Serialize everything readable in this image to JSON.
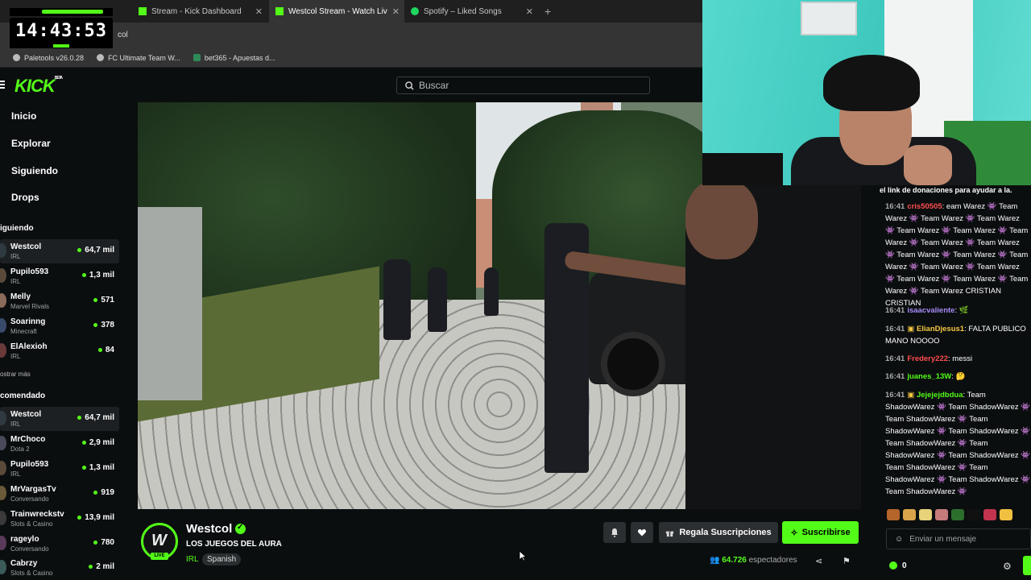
{
  "overlay": {
    "clock": "14:43:53"
  },
  "browser": {
    "tabs": [
      {
        "label": "Stream - Kick Dashboard",
        "active": false
      },
      {
        "label": "Westcol Stream - Watch Liv",
        "active": true
      },
      {
        "label": "Spotify – Liked Songs",
        "active": false
      }
    ],
    "address_fragment": "col",
    "bookmarks": [
      "Paletools v26.0.28",
      "FC Ultimate Team W...",
      "bet365 - Apuestas d..."
    ]
  },
  "header": {
    "logo": "KICK",
    "logo_badge": "BETA",
    "search_placeholder": "Buscar"
  },
  "sidebar": {
    "nav": [
      "Inicio",
      "Explorar",
      "Siguiendo",
      "Drops"
    ],
    "following_title": "iguiendo",
    "following": [
      {
        "name": "Westcol",
        "category": "IRL",
        "viewers": "64,7 mil"
      },
      {
        "name": "Pupilo593",
        "category": "IRL",
        "viewers": "1,3 mil"
      },
      {
        "name": "Melly",
        "category": "Marvel Rivals",
        "viewers": "571"
      },
      {
        "name": "Soarinng",
        "category": "Minecraft",
        "viewers": "378"
      },
      {
        "name": "ElAlexioh",
        "category": "IRL",
        "viewers": "84"
      }
    ],
    "show_more": "ostrar más",
    "recommended_title": "comendado",
    "recommended": [
      {
        "name": "Westcol",
        "category": "IRL",
        "viewers": "64,7 mil"
      },
      {
        "name": "MrChoco",
        "category": "Dota 2",
        "viewers": "2,9 mil"
      },
      {
        "name": "Pupilo593",
        "category": "IRL",
        "viewers": "1,3 mil"
      },
      {
        "name": "MrVargasTv",
        "category": "Conversando",
        "viewers": "919"
      },
      {
        "name": "Trainwreckstv",
        "category": "Slots & Casino",
        "viewers": "13,9 mil"
      },
      {
        "name": "rageylo",
        "category": "Conversando",
        "viewers": "780"
      },
      {
        "name": "Cabrzy",
        "category": "Slots & Casino",
        "viewers": "2 mil"
      }
    ]
  },
  "channel": {
    "name": "Westcol",
    "stream_title": "LOS JUEGOS DEL AURA",
    "category": "IRL",
    "language": "Spanish",
    "live_badge": "LIVE",
    "gift_label": "Regala Suscripciones",
    "subscribe_label": "Suscribirse",
    "viewer_count": "64.726",
    "viewer_suffix": "espectadores"
  },
  "chat": {
    "pinned": "el link de donaciones para ayudar a la.",
    "messages": [
      {
        "time": "16:41",
        "user": "cris50505",
        "color": "#ff4d4d",
        "text": "eam Warez 👾 Team Warez 👾 Team Warez 👾 Team Warez 👾 Team Warez 👾 Team Warez 👾 Team Warez 👾 Team Warez 👾 Team Warez 👾 Team Warez 👾 Team Warez 👾 Team Warez 👾 Team Warez 👾 Team Warez 👾 Team Warez 👾 Team Warez 👾 Team Warez 👾 Team Warez CRISTIAN CRISTIAN"
      },
      {
        "time": "16:41",
        "user": "isaacvaliente",
        "color": "#a78bfa",
        "text": "🌿"
      },
      {
        "time": "16:41",
        "user": "ElianDjesus1",
        "color": "#f5c842",
        "text": "FALTA PUBLICO MANO NOOOO"
      },
      {
        "time": "16:41",
        "user": "Fredery222",
        "color": "#ff4d4d",
        "text": "messi"
      },
      {
        "time": "16:41",
        "user": "juanes_13W",
        "color": "#53fc18",
        "text": "🤔"
      },
      {
        "time": "16:41",
        "user": "Jejejejdbdua",
        "color": "#53fc18",
        "text": "Team ShadowWarez 👾 Team ShadowWarez 👾 Team ShadowWarez 👾 Team ShadowWarez 👾 Team ShadowWarez 👾 Team ShadowWarez 👾 Team ShadowWarez 👾 Team ShadowWarez 👾 Team ShadowWarez 👾 Team ShadowWarez 👾 Team ShadowWarez 👾 Team ShadowWarez 👾"
      }
    ],
    "input_placeholder": "Enviar un mensaje",
    "kick_coins": "0"
  }
}
